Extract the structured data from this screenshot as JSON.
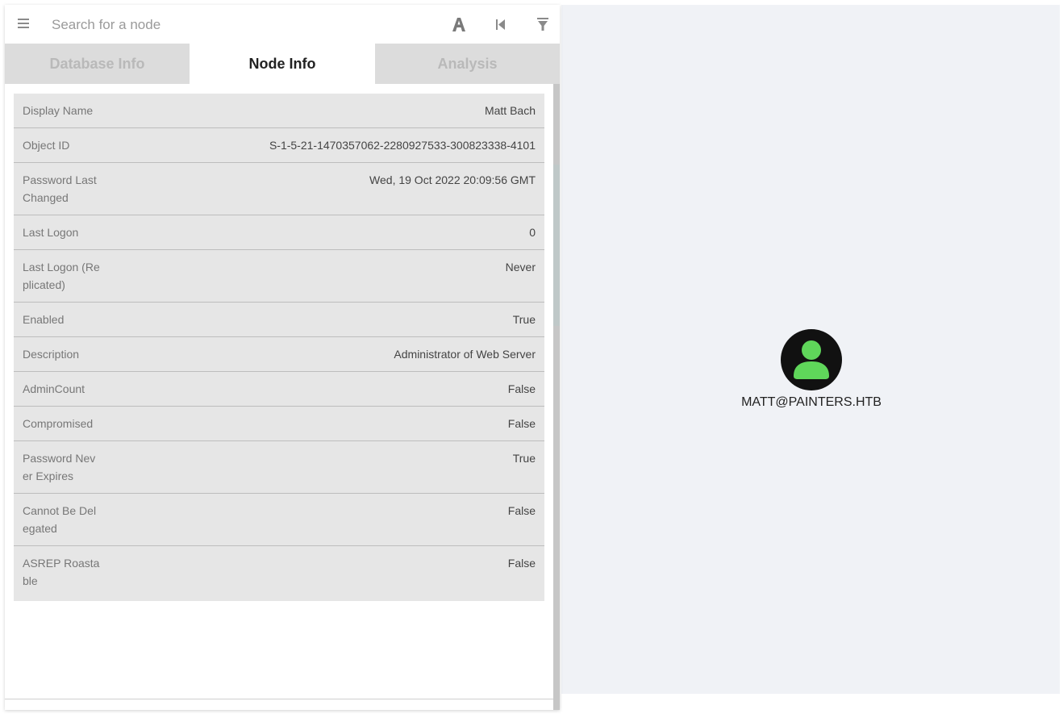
{
  "search": {
    "placeholder": "Search for a node"
  },
  "toolbar": {
    "icons": [
      "pathfinding-icon",
      "back-icon",
      "filter-icon"
    ]
  },
  "tabs": [
    {
      "label": "Database Info",
      "active": false
    },
    {
      "label": "Node Info",
      "active": true
    },
    {
      "label": "Analysis",
      "active": false
    }
  ],
  "properties": [
    {
      "label": "Display Name",
      "value": "Matt Bach"
    },
    {
      "label": "Object ID",
      "value": "S-1-5-21-1470357062-2280927533-300823338-4101"
    },
    {
      "label": "Password Last Changed",
      "value": "Wed, 19 Oct 2022 20:09:56 GMT"
    },
    {
      "label": "Last Logon",
      "value": "0"
    },
    {
      "label": "Last Logon (Replicated)",
      "value": "Never"
    },
    {
      "label": "Enabled",
      "value": "True"
    },
    {
      "label": "Description",
      "value": "Administrator of Web Server"
    },
    {
      "label": "AdminCount",
      "value": "False"
    },
    {
      "label": "Compromised",
      "value": "False"
    },
    {
      "label": "Password Never Expires",
      "value": "True"
    },
    {
      "label": "Cannot Be Delegated",
      "value": "False"
    },
    {
      "label": "ASREP Roastable",
      "value": "False"
    }
  ],
  "graph": {
    "node_label": "MATT@PAINTERS.HTB",
    "node_icon": "user-icon",
    "node_color": "#5fd65a",
    "node_bg": "#111111"
  },
  "colors": {
    "tab_inactive_bg": "#dcdcdc",
    "tab_inactive_text": "#b9b9b9",
    "table_bg": "#e6e6e6",
    "graph_bg": "#f0f2f6"
  }
}
